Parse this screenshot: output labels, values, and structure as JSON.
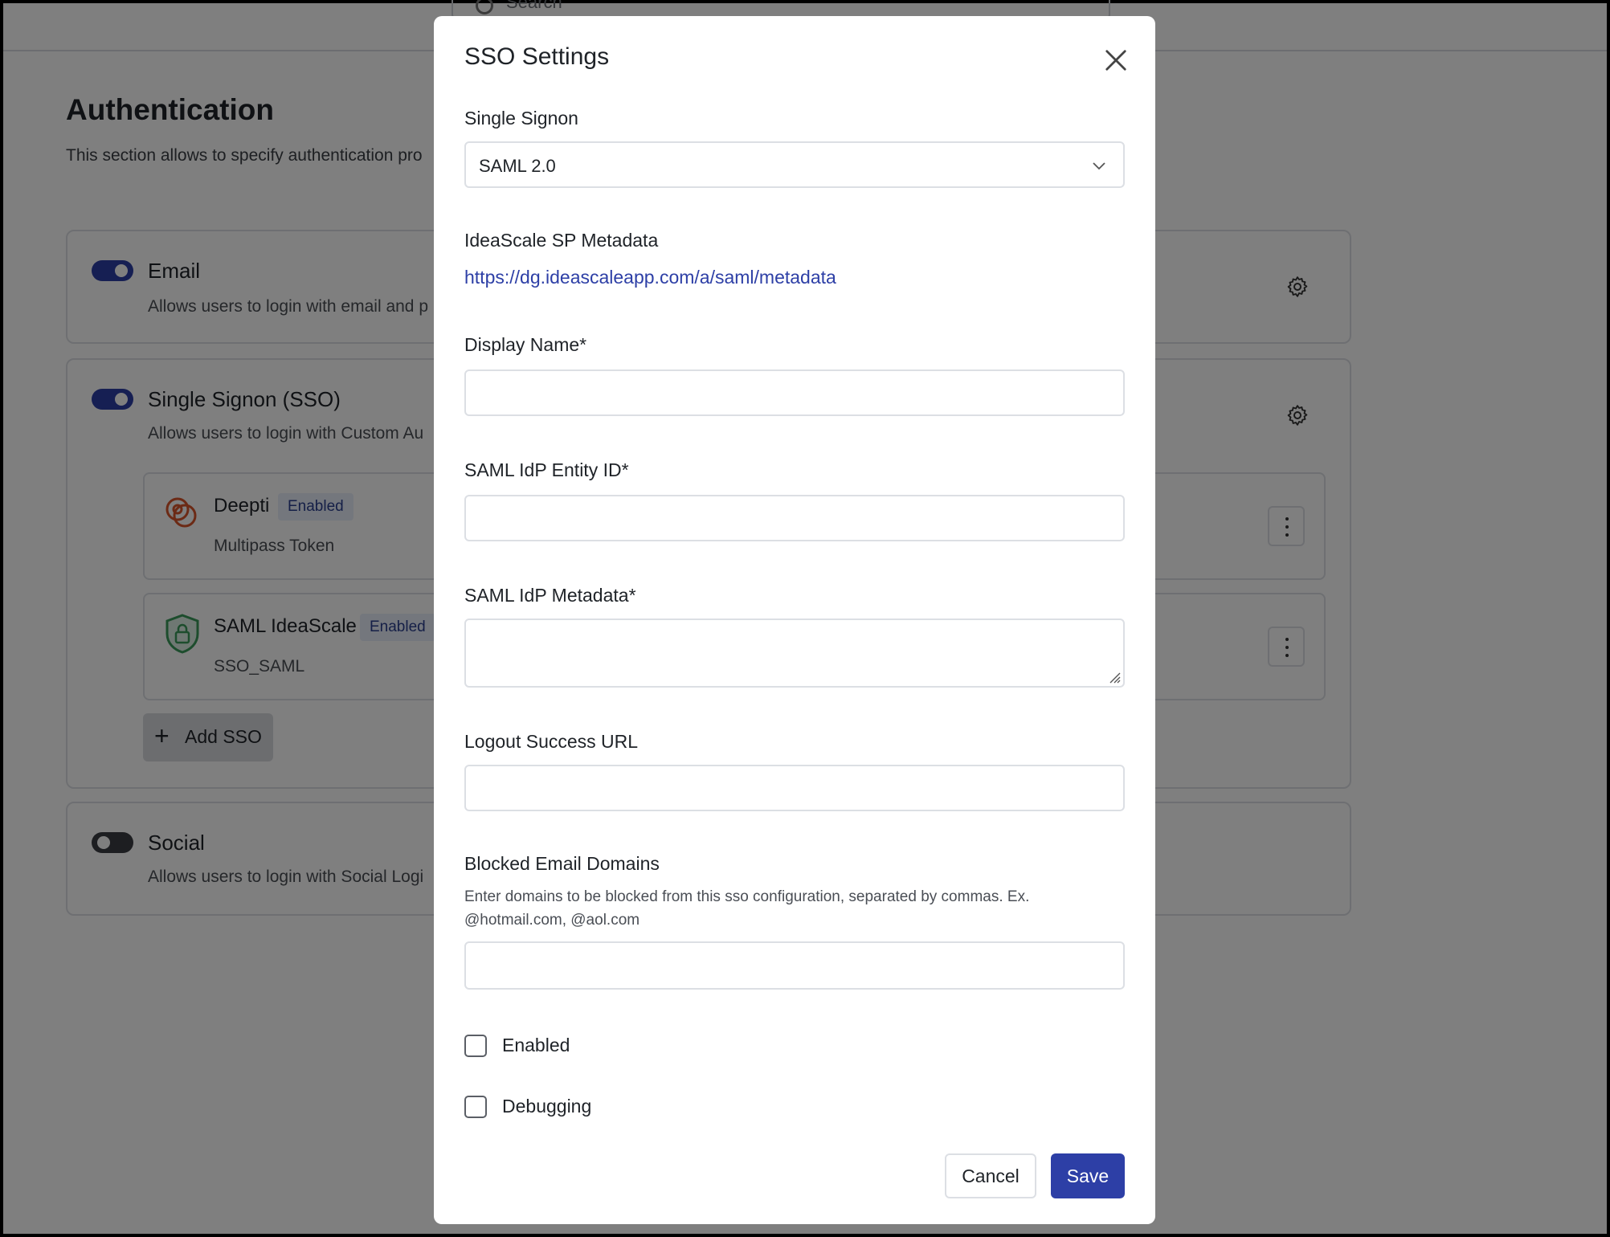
{
  "background": {
    "search_placeholder": "Search",
    "title": "Authentication",
    "description": "This section allows to specify authentication pro",
    "sections": {
      "email": {
        "title": "Email",
        "subtitle": "Allows users to login with email and p",
        "enabled": true
      },
      "sso": {
        "title": "Single Signon (SSO)",
        "subtitle": "Allows users to login with Custom Au",
        "enabled": true
      },
      "social": {
        "title": "Social",
        "subtitle": "Allows users to login with Social Logi",
        "enabled": false
      }
    },
    "providers": [
      {
        "name": "Deepti",
        "status": "Enabled",
        "type": "Multipass Token",
        "icon": "multipass-icon"
      },
      {
        "name": "SAML IdeaScale",
        "status": "Enabled",
        "type": "SSO_SAML",
        "icon": "shield-lock-icon"
      }
    ],
    "add_sso_label": "Add SSO"
  },
  "modal": {
    "title": "SSO Settings",
    "single_signon_label": "Single Signon",
    "single_signon_value": "SAML 2.0",
    "sp_metadata_label": "IdeaScale SP Metadata",
    "sp_metadata_url": "https://dg.ideascaleapp.com/a/saml/metadata",
    "display_name_label": "Display Name*",
    "display_name_value": "",
    "entity_id_label": "SAML IdP Entity ID*",
    "entity_id_value": "",
    "idp_metadata_label": "SAML IdP Metadata*",
    "idp_metadata_value": "",
    "logout_url_label": "Logout Success URL",
    "logout_url_value": "",
    "blocked_domains_label": "Blocked Email Domains",
    "blocked_domains_help": "Enter domains to be blocked from this sso configuration, separated by commas. Ex. @hotmail.com, @aol.com",
    "blocked_domains_value": "",
    "enabled_label": "Enabled",
    "enabled_checked": false,
    "debugging_label": "Debugging",
    "debugging_checked": false,
    "cancel_label": "Cancel",
    "save_label": "Save"
  },
  "colors": {
    "primary": "#2d3fa6",
    "overlay": "rgba(0,0,0,0.5)",
    "badge_bg": "#e8eefb"
  }
}
